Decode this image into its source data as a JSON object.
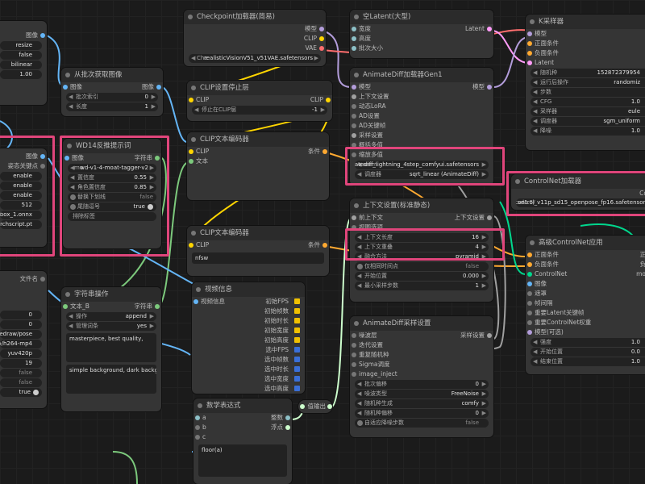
{
  "colors": {
    "highlight": "#e0457b",
    "image": "#64b5f6",
    "string": "#7cc97c",
    "clip": "#ffd500",
    "model": "#b39ddb",
    "latent": "#ff9cf9",
    "conditioning": "#ffa931",
    "vae": "#ff6e6e",
    "context": "#a0a0a0",
    "int": "#8dc0c7",
    "controlnet": "#00d78d",
    "fps_yellow": "#f0c000",
    "fps_blue": "#3a6fd8"
  },
  "left_top": {
    "out_label": "图像",
    "values": [
      "resize",
      "false",
      "bilinear",
      "1.00"
    ]
  },
  "batch": {
    "title": "从批次获取图像",
    "in_label": "图像",
    "out_label": "图像",
    "w1_label": "批次索引",
    "w1_value": "0",
    "w2_label": "长度",
    "w2_value": "1"
  },
  "ckpt": {
    "title": "Checkpoint加载器(简易)",
    "outs": [
      "模型",
      "CLIP",
      "VAE"
    ],
    "value": "realisticVisionV51_v51VAE.safetensors",
    "value_prefix": "Che"
  },
  "empty_latent": {
    "title": "空Latent(大型)",
    "ins": [
      "宽度",
      "高度",
      "批次大小"
    ],
    "out_label": "Latent"
  },
  "ksampler": {
    "title": "K采样器",
    "ins": [
      "模型",
      "正面条件",
      "负面条件",
      "Latent"
    ],
    "w": [
      {
        "label": "随机种",
        "value": "152872379954"
      },
      {
        "label": "运行后操作",
        "value": "randomiz"
      },
      {
        "label": "步数",
        "value": ""
      },
      {
        "label": "CFG",
        "value": "1.0"
      },
      {
        "label": "采样器",
        "value": "eule"
      },
      {
        "label": "调度器",
        "value": "sgm_uniform"
      },
      {
        "label": "降噪",
        "value": "1.0"
      }
    ]
  },
  "clip_stop": {
    "title": "CLIP设置停止层",
    "in_label": "CLIP",
    "out_label": "CLIP",
    "w_label": "停止在CLIP层",
    "w_value": "-1"
  },
  "animdiff": {
    "title": "AnimateDiff加载器Gen1",
    "ins": [
      "模型",
      "上下文设置",
      "动态LoRA",
      "AD设置",
      "AD关键帧",
      "采样设置",
      "概括多值",
      "缩放多值"
    ],
    "out_label": "模型",
    "model_prefix": "anim",
    "model_value": "animatediff_lightning_4step_comfyui.safetensors",
    "sched_label": "调度器",
    "sched_value": "sqrt_linear (AnimateDiff)"
  },
  "wd14": {
    "title": "WD14反推提示词",
    "in_label": "图像",
    "out_label": "字符串",
    "model_prefix": "mo",
    "model_value": "wd-v1-4-moat-tagger-v2",
    "w": [
      {
        "label": "置信度",
        "value": "0.55"
      },
      {
        "label": "角色置信度",
        "value": "0.85"
      },
      {
        "label": "替换下划线",
        "value": "false"
      },
      {
        "label": "尾随逗号",
        "value": "true"
      },
      {
        "label": "排除标签",
        "value": ""
      }
    ]
  },
  "left_mid": {
    "out_label": "图像",
    "out2_label": "姿态关键点",
    "values": [
      "enable",
      "enable",
      "enable",
      "512",
      "dw-ll_ucoco_384_bbox_1.onnx",
      "dw-ll_ucoco_384_bbox_torchscript.pt"
    ]
  },
  "clip_text1": {
    "title": "CLIP文本编码器",
    "ins": [
      "CLIP",
      "文本"
    ],
    "out_label": "条件"
  },
  "clip_text2": {
    "title": "CLIP文本编码器",
    "in_label": "CLIP",
    "out_label": "条件",
    "text": "nfsw"
  },
  "context": {
    "title": "上下文设置(标准静态)",
    "in_label": "前上下文",
    "out_label": "上下文设置",
    "in2_label": "视图选项",
    "w": [
      {
        "label": "上下文长度",
        "value": "16"
      },
      {
        "label": "上下文重叠",
        "value": "4"
      },
      {
        "label": "融合方法",
        "value": "pyramid"
      },
      {
        "label": "仅相同时间点",
        "value": "false"
      },
      {
        "label": "开始位置",
        "value": "0.000"
      },
      {
        "label": "最小采样步数",
        "value": "1"
      }
    ]
  },
  "controlnet_loader": {
    "title": "ControlNet加载器",
    "out_label": "Co",
    "value": "control_v11p_sd15_openpose_fp16.safetensors",
    "prefix": "sd1.5/"
  },
  "adv_controlnet": {
    "title": "高级ControlNet应用",
    "ins": [
      "正面条件",
      "负面条件",
      "ControlNet",
      "图像",
      "遮罩",
      "帧间隔",
      "重要Latent关键帧",
      "重要ControlNet权重",
      "模型(可选)"
    ],
    "outs": [
      "正",
      "负",
      "mo"
    ],
    "w": [
      {
        "label": "强度",
        "value": "1.0"
      },
      {
        "label": "开始位置",
        "value": "0.0"
      },
      {
        "label": "结束位置",
        "value": "1.0"
      }
    ]
  },
  "left_low": {
    "out_label": "文件名",
    "values": [
      "0",
      "0",
      "ComfyUI/video-redraw/pose",
      "video/h264-mp4",
      "yuv420p",
      "19",
      "false",
      "false",
      "true"
    ]
  },
  "string_op": {
    "title": "字符串操作",
    "in_label": "文本_B",
    "out_label": "字符串",
    "w": [
      {
        "label": "操作",
        "value": "append"
      },
      {
        "label": "管理词条",
        "value": "yes"
      }
    ],
    "text1": "masterpiece, best quality,",
    "text2": "simple background, dark background"
  },
  "video_info": {
    "title": "视频信息",
    "in_label": "视频信息",
    "outs": [
      {
        "label": "初始FPS",
        "color": "#f0c000"
      },
      {
        "label": "初始帧数",
        "color": "#f0c000"
      },
      {
        "label": "初始时长",
        "color": "#f0c000"
      },
      {
        "label": "初始宽度",
        "color": "#f0c000"
      },
      {
        "label": "初始高度",
        "color": "#f0c000"
      },
      {
        "label": "选中FPS",
        "color": "#3a6fd8"
      },
      {
        "label": "选中帧数",
        "color": "#3a6fd8"
      },
      {
        "label": "选中时长",
        "color": "#3a6fd8"
      },
      {
        "label": "选中宽度",
        "color": "#3a6fd8"
      },
      {
        "label": "选中高度",
        "color": "#3a6fd8"
      }
    ]
  },
  "math": {
    "title": "数学表达式",
    "ins": [
      "a",
      "b",
      "c"
    ],
    "outs": [
      "整数",
      "浮点"
    ],
    "expr": "floor(a)"
  },
  "reroute": {
    "in_label": "",
    "out_label": "值输出"
  },
  "ad_sample": {
    "title": "AnimateDiff采样设置",
    "in_label": "噪波层",
    "out_label": "采样设置",
    "ins2": [
      "迭代设置",
      "重复随机种",
      "Sigma调度"
    ],
    "input_label": "image_inject",
    "w": [
      {
        "label": "批次偏移",
        "value": "0"
      },
      {
        "label": "噪波类型",
        "value": "FreeNoise"
      },
      {
        "label": "随机种生成",
        "value": "comfy"
      },
      {
        "label": "随机种偏移",
        "value": "0"
      },
      {
        "label": "自适应降噪步数",
        "value": "false"
      }
    ]
  }
}
